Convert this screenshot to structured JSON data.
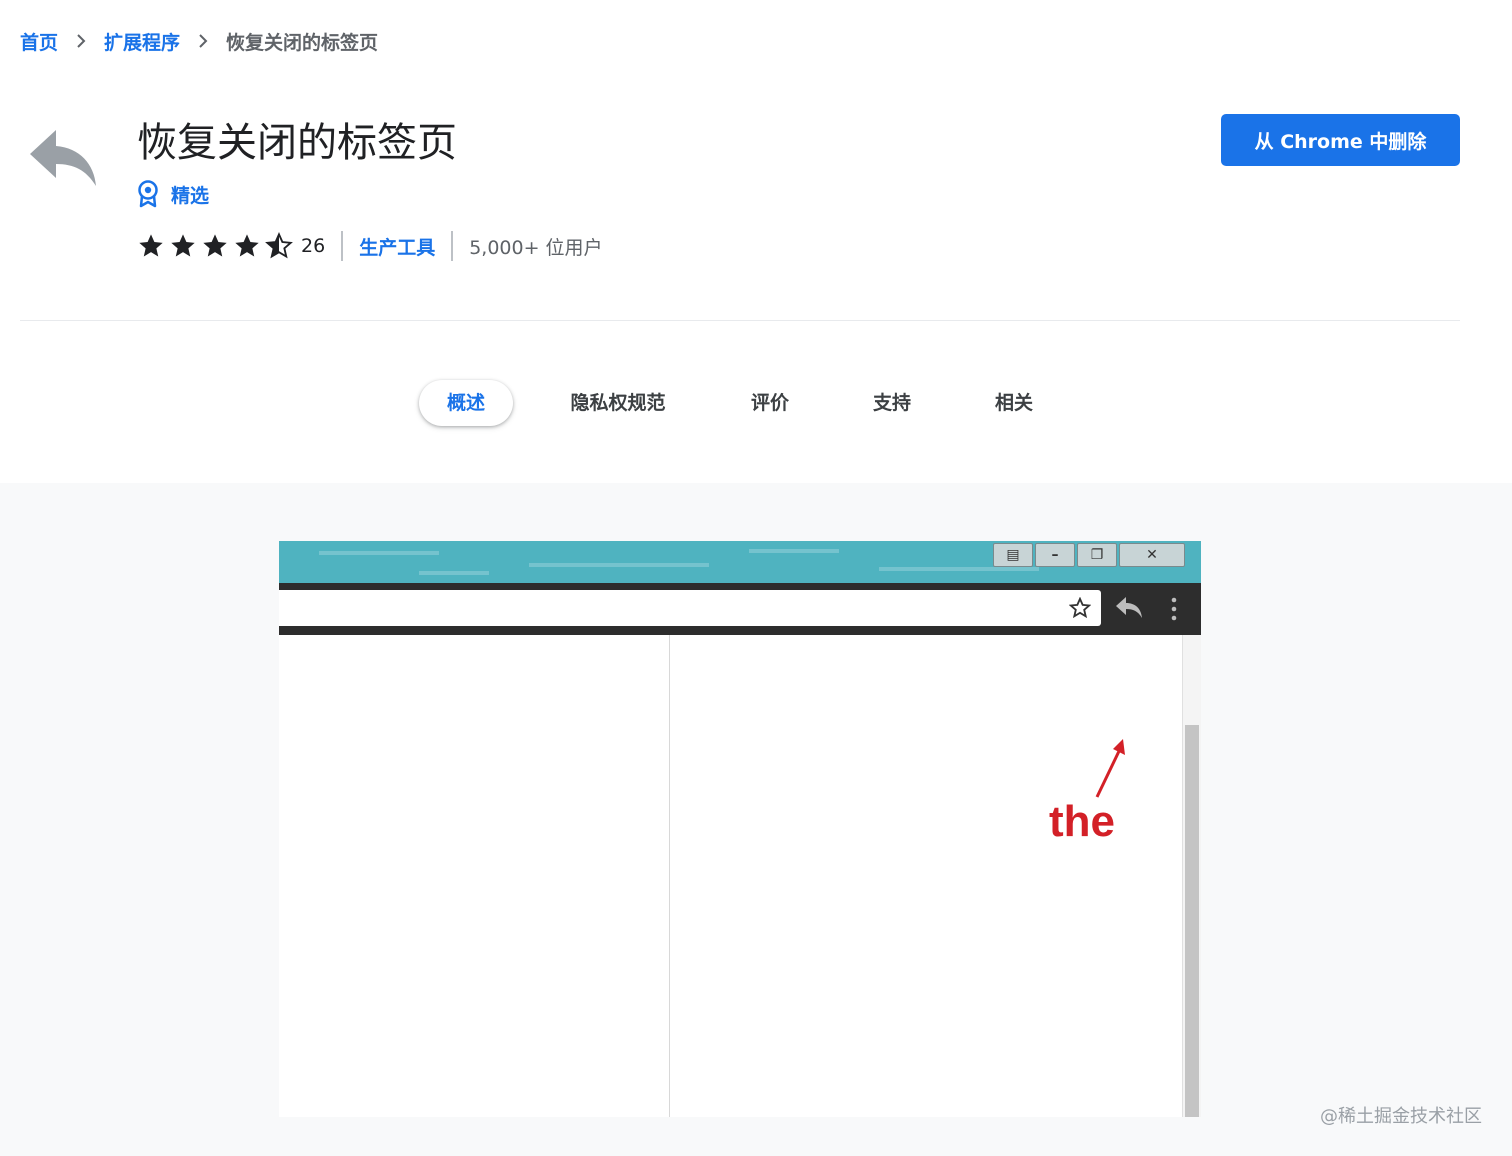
{
  "breadcrumb": {
    "home": "首页",
    "extensions": "扩展程序",
    "current": "恢复关闭的标签页"
  },
  "extension": {
    "name": "恢复关闭的标签页",
    "featured_label": "精选",
    "rating": 4.5,
    "rating_count": "26",
    "category": "生产工具",
    "users": "5,000+ 位用户",
    "icon": "reply-arrow-icon"
  },
  "actions": {
    "remove_label": "从 Chrome 中删除"
  },
  "tabs": [
    {
      "label": "概述",
      "active": true
    },
    {
      "label": "隐私权规范",
      "active": false
    },
    {
      "label": "评价",
      "active": false
    },
    {
      "label": "支持",
      "active": false
    },
    {
      "label": "相关",
      "active": false
    }
  ],
  "screenshot": {
    "annotation_text": "the",
    "annotation_color": "#d32027"
  },
  "watermark": "@稀土掘金技术社区",
  "colors": {
    "accent": "#1a73e8",
    "star": "#202124",
    "gallery_bg": "#f8f9fa"
  }
}
